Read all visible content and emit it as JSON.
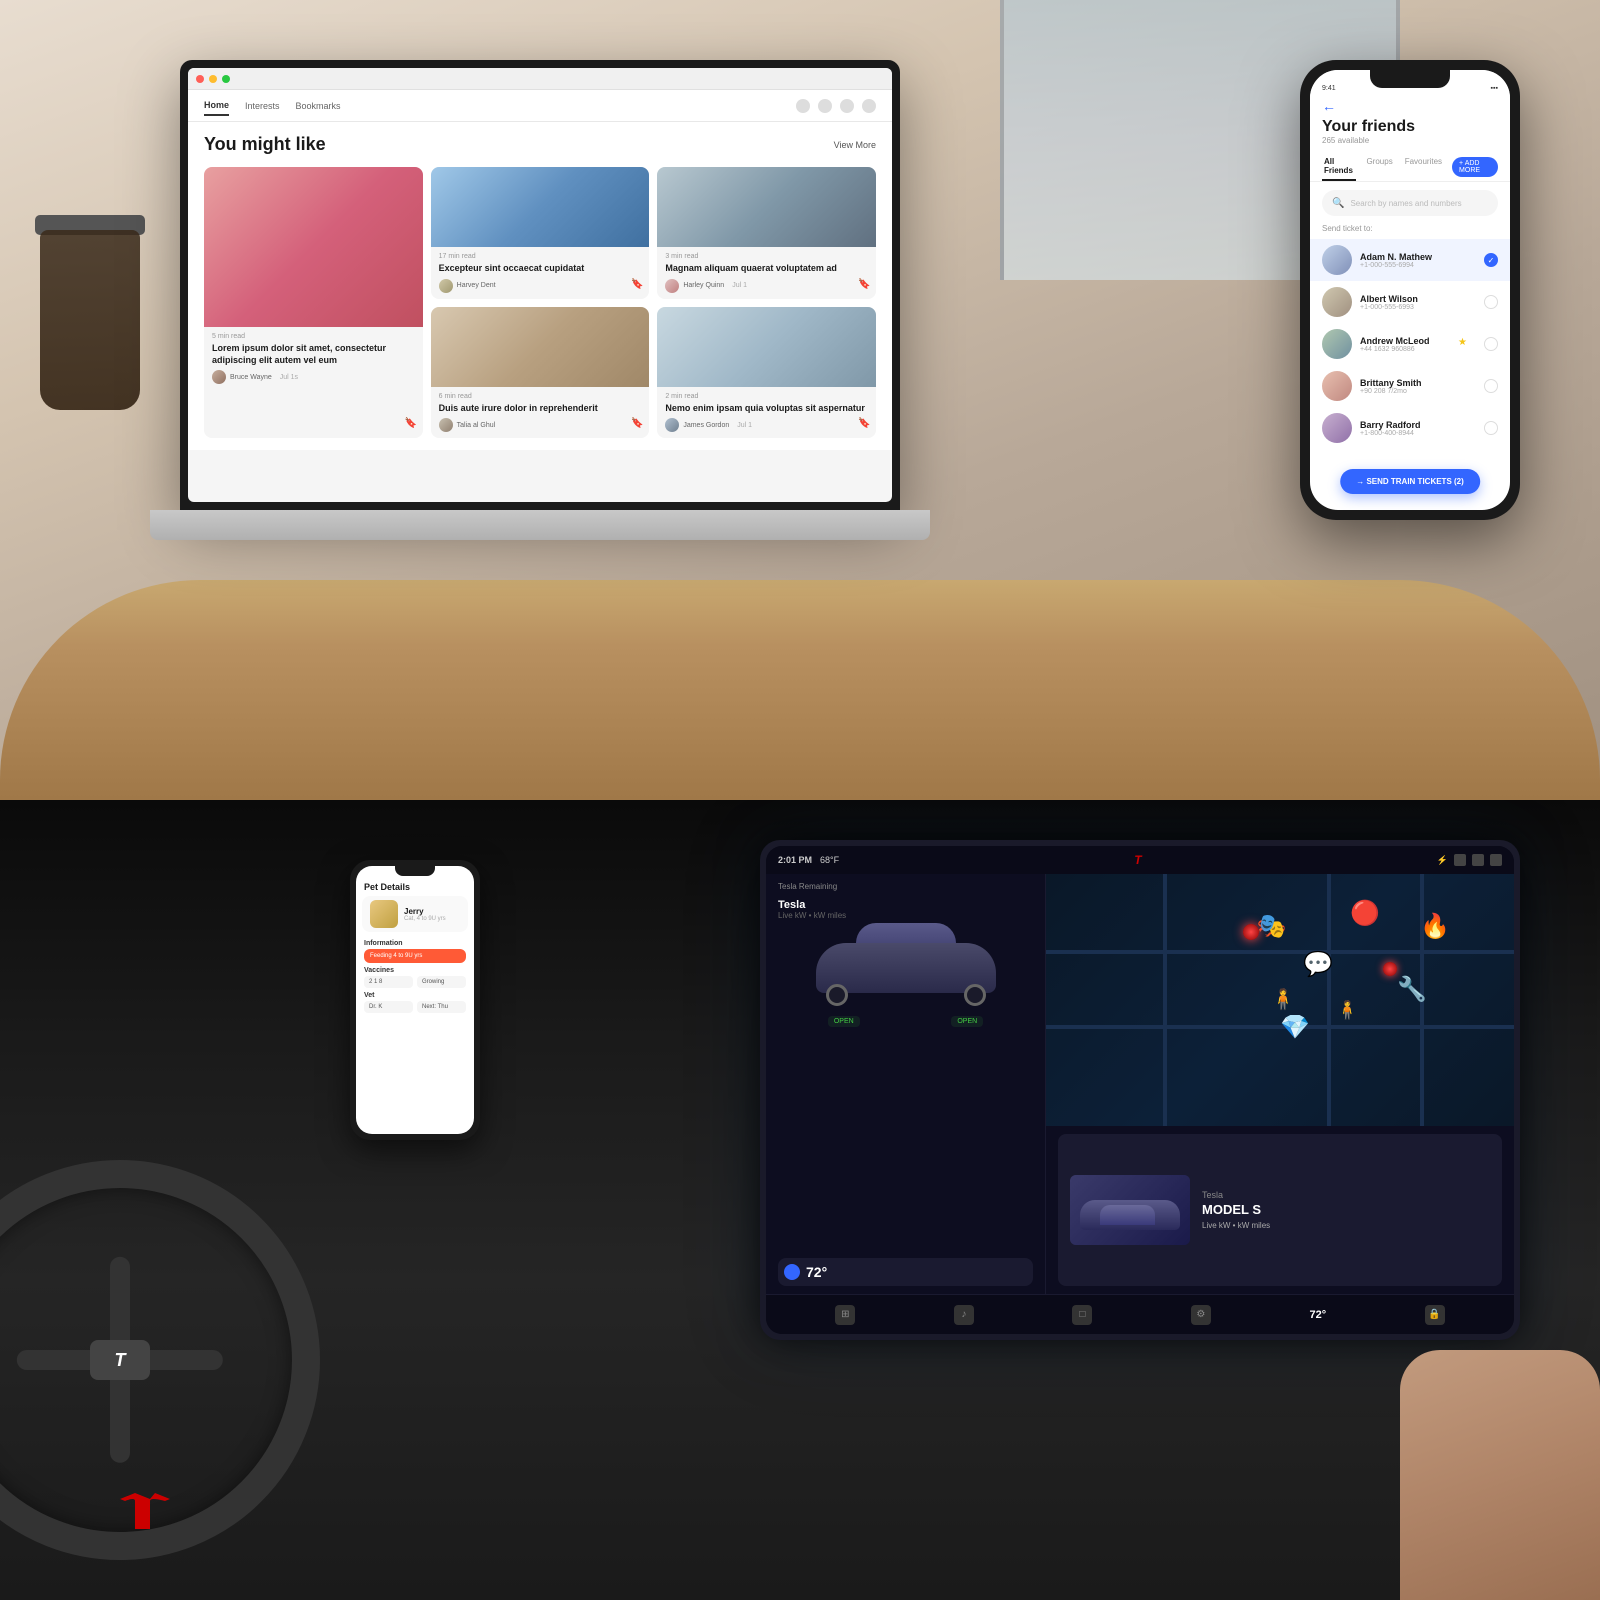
{
  "top_half": {
    "laptop": {
      "nav_tabs": [
        {
          "label": "Home",
          "active": true
        },
        {
          "label": "Interests",
          "active": false
        },
        {
          "label": "Bookmarks",
          "active": false
        }
      ],
      "page_title": "You might like",
      "view_more": "View More",
      "cards": [
        {
          "id": "card1",
          "read_time": "5 min read",
          "title": "Lorem ipsum dolor sit amet, consectetur adipiscing elit autem vel eum",
          "author": "Bruce Wayne",
          "time_ago": "Jul 1s",
          "color": "pink"
        },
        {
          "id": "card2",
          "read_time": "17 min read",
          "title": "Excepteur sint occaecat cupidatat",
          "author": "Harvey Dent",
          "time_ago": "",
          "color": "blue"
        },
        {
          "id": "card3",
          "read_time": "3 min read",
          "title": "Magnam aliquam quaerat voluptatem ad",
          "author": "Harley Quinn",
          "time_ago": "Jul 1",
          "color": "gray"
        },
        {
          "id": "card4",
          "read_time": "6 min read",
          "title": "Duis aute irure dolor in reprehenderit",
          "author": "Talia al Ghul",
          "time_ago": "",
          "color": "beige"
        },
        {
          "id": "card5",
          "read_time": "2 min read",
          "title": "Nemo enim ipsam quia voluptas sit aspernatur",
          "author": "James Gordon",
          "time_ago": "Jul 1",
          "color": "light"
        }
      ]
    },
    "phone": {
      "status_time": "9:41",
      "back_arrow": "←",
      "title": "Your friends",
      "subtitle": "265 available",
      "tabs": [
        {
          "label": "All Friends",
          "active": true
        },
        {
          "label": "Groups",
          "active": false
        },
        {
          "label": "Favourites",
          "active": false
        }
      ],
      "add_button": "+ ADD MORE",
      "search_placeholder": "Search by names and numbers",
      "send_ticket_label": "Send ticket to:",
      "friends": [
        {
          "id": "adam",
          "name": "Adam N. Mathew",
          "phone": "+1-000-555-6994",
          "checked": true,
          "starred": false,
          "avatar_color": "adam"
        },
        {
          "id": "albert",
          "name": "Albert Wilson",
          "phone": "+1-000-555-6993",
          "checked": false,
          "starred": false,
          "avatar_color": "albert"
        },
        {
          "id": "andrew",
          "name": "Andrew McLeod",
          "phone": "+44 1632 960886",
          "checked": false,
          "starred": true,
          "avatar_color": "andrew"
        },
        {
          "id": "brittany",
          "name": "Brittany Smith",
          "phone": "+90 208 7/2mo",
          "checked": false,
          "starred": false,
          "avatar_color": "brittany"
        },
        {
          "id": "barry",
          "name": "Barry Radford",
          "phone": "+1-800-400-8944",
          "checked": false,
          "starred": false,
          "avatar_color": "barry"
        }
      ],
      "send_button": "→ SEND TRAIN TICKETS (2)"
    }
  },
  "bottom_half": {
    "tesla_logo": "T",
    "car_phone": {
      "title": "Pet Details",
      "pet_name": "Jerry",
      "pet_breed": "Cat, 4 to 9U yrs",
      "info_section": "Information",
      "info_text": "Feeding 4 to 9U yrs",
      "vaccines_section": "Vaccines",
      "vet_section": "Vet",
      "stats": [
        "2 1 8",
        "Growing"
      ]
    },
    "tesla_screen": {
      "time": "2:01 PM",
      "temperature": "68°F",
      "charge": "⚡",
      "car_name": "Tesla",
      "car_model": "MODEL S",
      "car_sub": "Live kW • kW miles",
      "door_labels": [
        "OPEN",
        "OPEN"
      ],
      "climate_temp": "72°",
      "map_games": [
        "🎭",
        "💬",
        "🔴",
        "🔧",
        "🔥",
        "💎"
      ],
      "ad_brand": "Tesla",
      "ad_model": "MODEL S",
      "ad_detail": "Live kW • kW  miles",
      "bottom_temp": "72°"
    }
  }
}
